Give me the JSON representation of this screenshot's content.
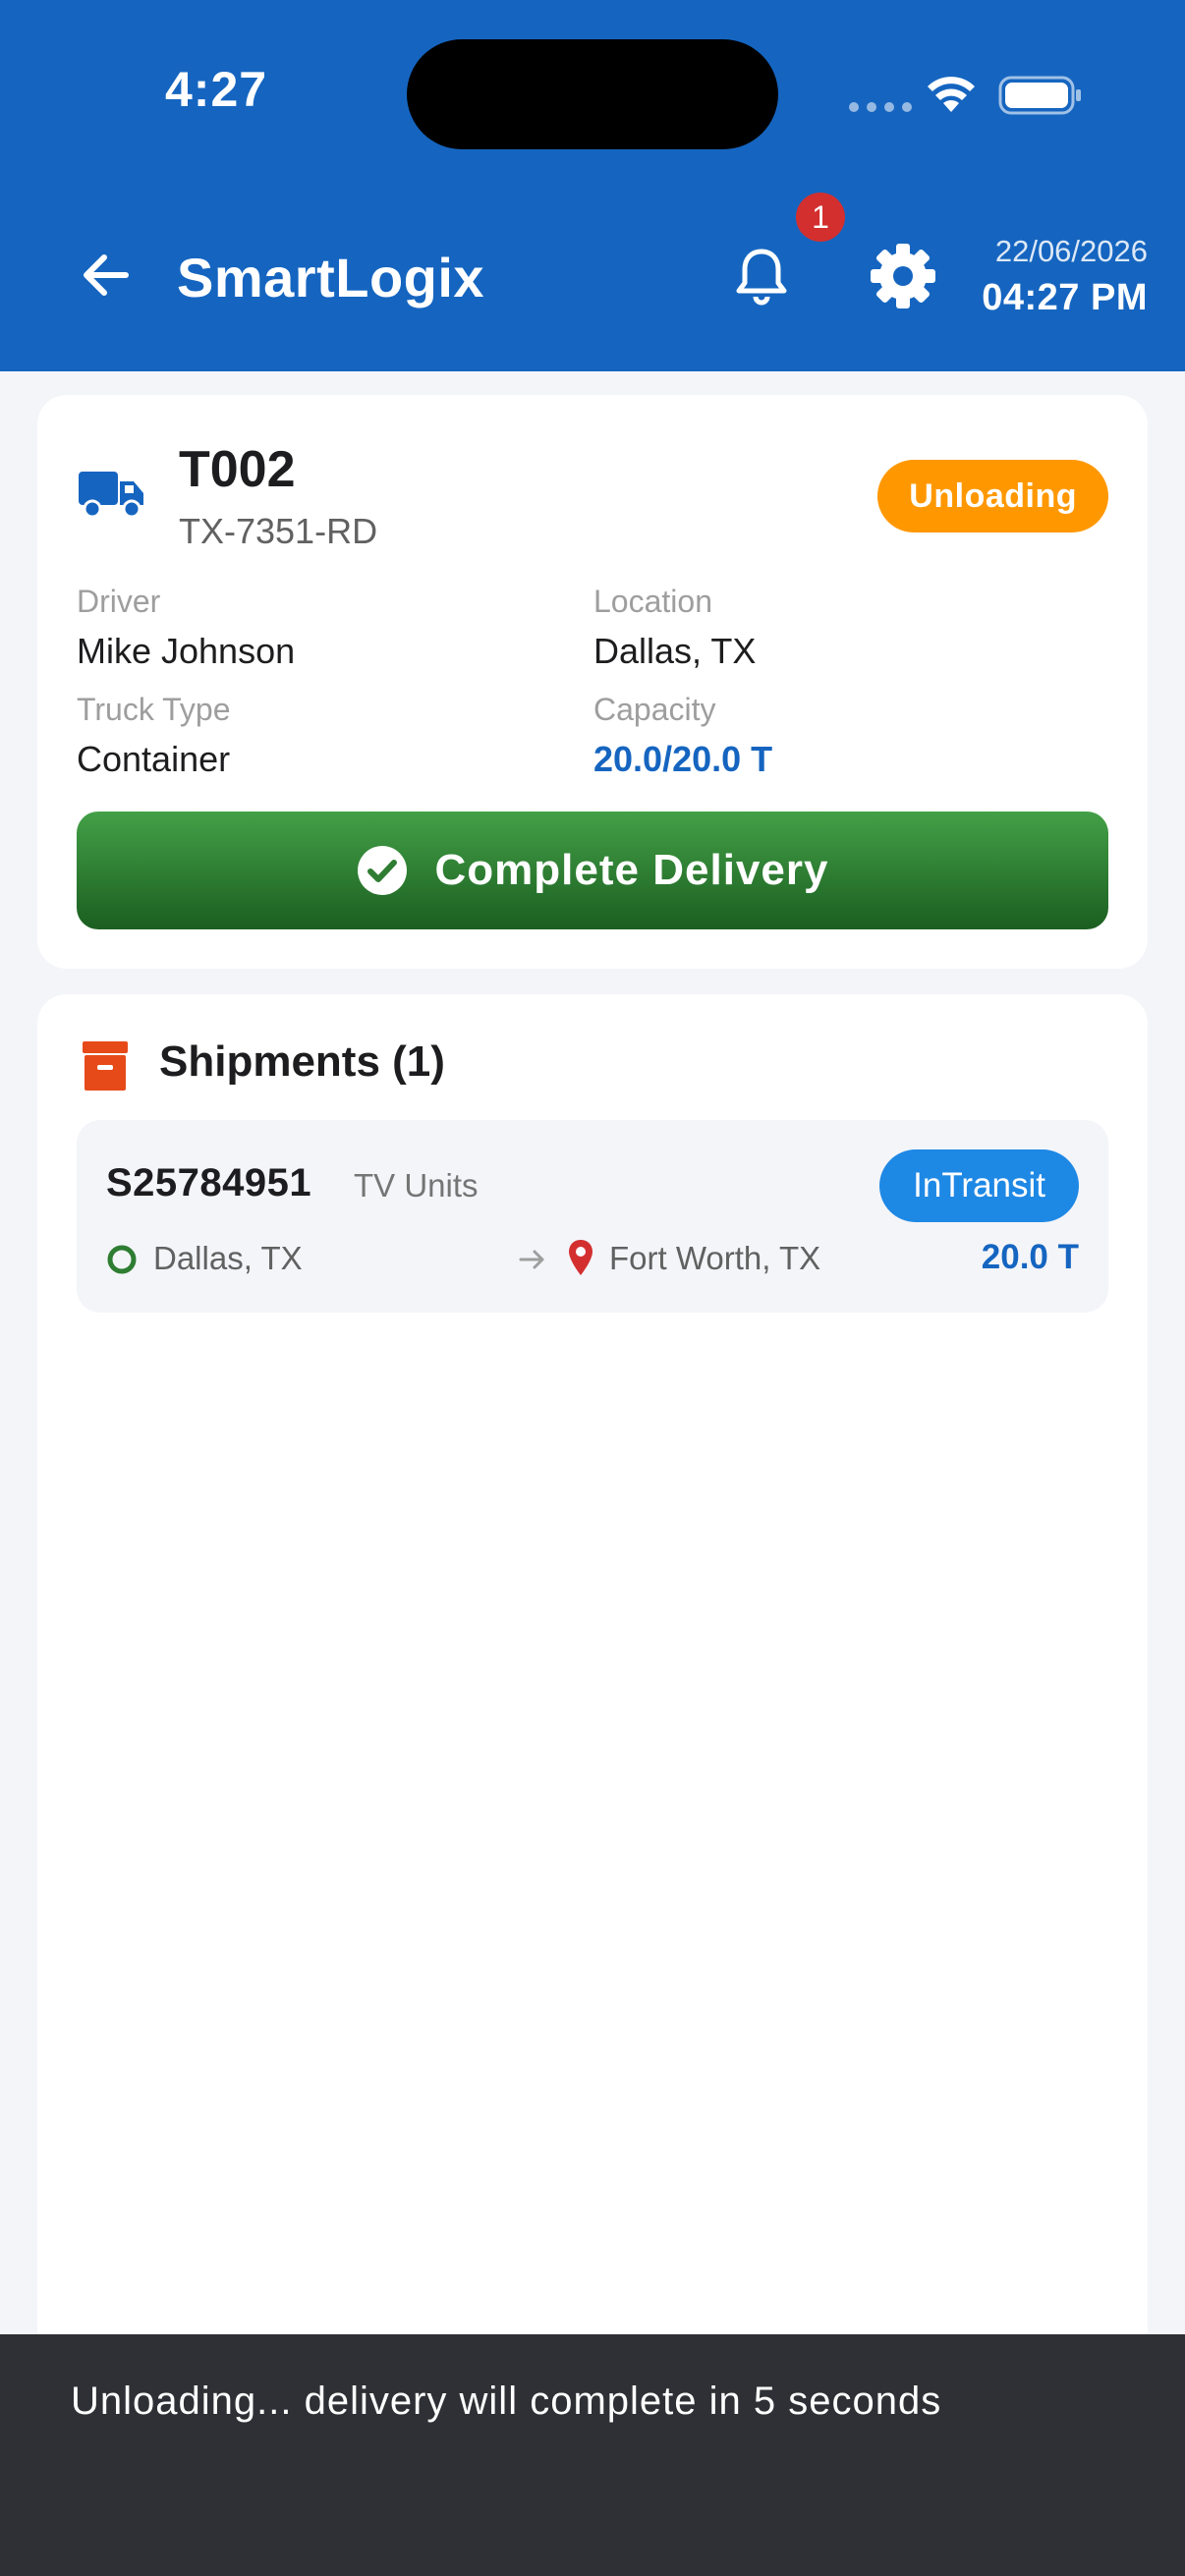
{
  "status_bar": {
    "time": "4:27"
  },
  "app_bar": {
    "title": "SmartLogix",
    "notification_count": "1",
    "date": "22/06/2026",
    "time": "04:27 PM"
  },
  "truck": {
    "id": "T002",
    "plate": "TX-7351-RD",
    "status": "Unloading",
    "fields": {
      "driver_label": "Driver",
      "driver": "Mike Johnson",
      "location_label": "Location",
      "location": "Dallas, TX",
      "type_label": "Truck Type",
      "type": "Container",
      "capacity_label": "Capacity",
      "capacity": "20.0/20.0 T"
    },
    "complete_button": "Complete Delivery"
  },
  "shipments": {
    "title": "Shipments (1)",
    "items": [
      {
        "id": "S25784951",
        "description": "TV Units",
        "status": "InTransit",
        "origin": "Dallas, TX",
        "destination": "Fort Worth, TX",
        "weight": "20.0 T"
      }
    ]
  },
  "snackbar": {
    "message": "Unloading... delivery will complete in 5 seconds"
  },
  "colors": {
    "primary": "#1565c0",
    "unloading": "#ff9800",
    "success": "#2e7d32",
    "in_transit": "#1e88e5",
    "badge": "#d32f2f",
    "snackbar": "#2f3035"
  },
  "icons": [
    "back-arrow-icon",
    "bell-icon",
    "gear-icon",
    "truck-icon",
    "check-circle-icon",
    "archive-box-icon",
    "origin-circle-icon",
    "arrow-right-icon",
    "location-pin-icon",
    "wifi-icon",
    "battery-icon"
  ]
}
